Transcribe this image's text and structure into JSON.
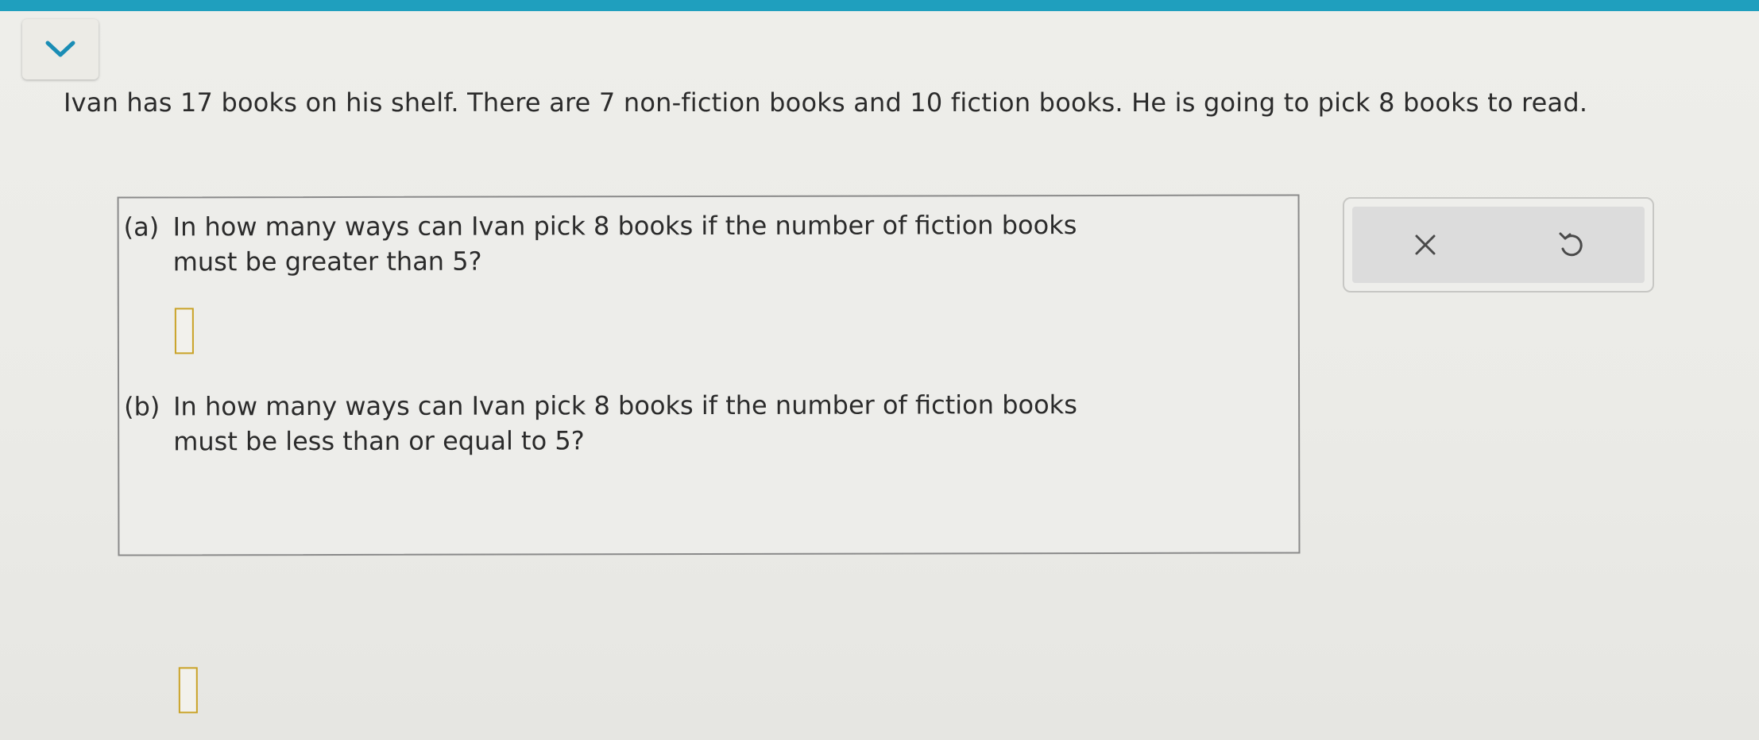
{
  "problem": {
    "stem": "Ivan has 17 books on his shelf. There are 7 non-fiction books and 10 fiction books. He is going to pick 8 books to read."
  },
  "parts": [
    {
      "label": "(a)",
      "line1": "In how many ways can Ivan pick 8 books if the number of fiction books",
      "line2": "must be greater than 5?",
      "answer": ""
    },
    {
      "label": "(b)",
      "line1": "In how many ways can Ivan pick 8 books if the number of fiction books",
      "line2": "must be less than or equal to 5?",
      "answer": ""
    }
  ],
  "tools": {
    "clear_icon": "x-icon",
    "undo_icon": "undo-icon"
  },
  "colors": {
    "topbar": "#1f9fbe",
    "accent_chevron": "#1a8db5",
    "answer_border": "#c9a227"
  }
}
